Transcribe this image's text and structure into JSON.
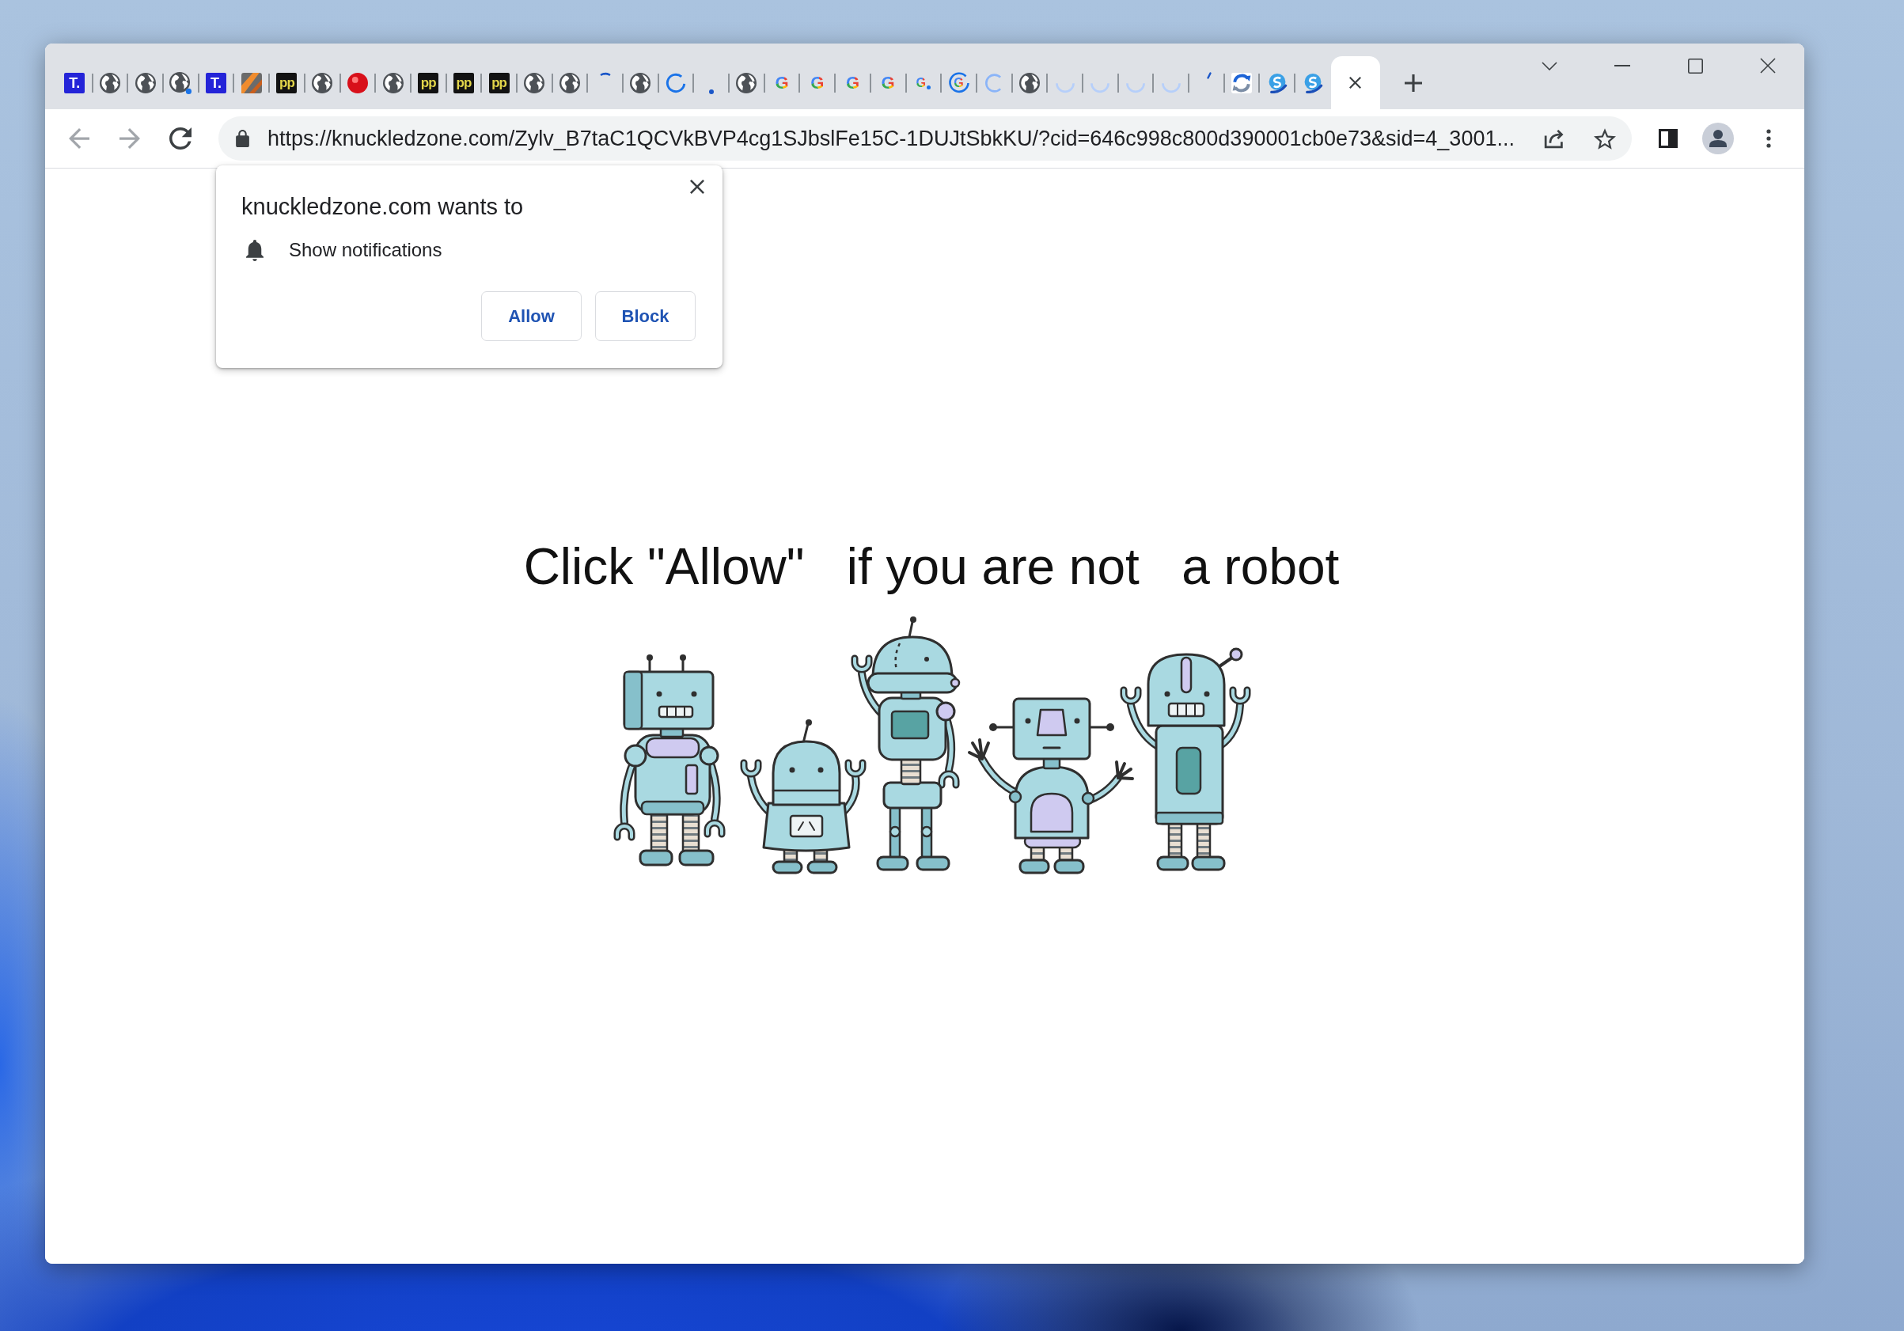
{
  "tabs": [
    {
      "kind": "tile",
      "text": "T.",
      "selected": false
    },
    {
      "kind": "globe",
      "selected": false
    },
    {
      "kind": "globe",
      "selected": false
    },
    {
      "kind": "globeload",
      "selected": false
    },
    {
      "kind": "tile",
      "text": "T.",
      "selected": false
    },
    {
      "kind": "photo",
      "selected": false
    },
    {
      "kind": "plate",
      "text": "pp",
      "selected": false
    },
    {
      "kind": "globe",
      "selected": false
    },
    {
      "kind": "dot",
      "selected": false
    },
    {
      "kind": "globe",
      "selected": false
    },
    {
      "kind": "plate",
      "text": "pp",
      "selected": false
    },
    {
      "kind": "plate",
      "text": "pp",
      "selected": false
    },
    {
      "kind": "plate",
      "text": "pp",
      "selected": false
    },
    {
      "kind": "globe",
      "selected": false
    },
    {
      "kind": "globe",
      "selected": false
    },
    {
      "kind": "spinstart",
      "selected": false
    },
    {
      "kind": "globe",
      "selected": false
    },
    {
      "kind": "spinner",
      "selected": false
    },
    {
      "kind": "speck",
      "selected": false
    },
    {
      "kind": "globe",
      "selected": false
    },
    {
      "kind": "google",
      "text": "G",
      "selected": false
    },
    {
      "kind": "google",
      "text": "G",
      "selected": false
    },
    {
      "kind": "google",
      "text": "G",
      "selected": false
    },
    {
      "kind": "google",
      "text": "G",
      "selected": false
    },
    {
      "kind": "googledot",
      "text": "G",
      "selected": false
    },
    {
      "kind": "googlering",
      "text": "G",
      "selected": false
    },
    {
      "kind": "spinlight",
      "selected": false
    },
    {
      "kind": "globe",
      "selected": false
    },
    {
      "kind": "spinfade",
      "selected": false
    },
    {
      "kind": "spinfade",
      "selected": false
    },
    {
      "kind": "spinfade",
      "selected": false
    },
    {
      "kind": "spinfade",
      "selected": false
    },
    {
      "kind": "spinend",
      "selected": false
    },
    {
      "kind": "arrows",
      "selected": false
    },
    {
      "kind": "swirl",
      "selected": false
    },
    {
      "kind": "swirl",
      "selected": false
    },
    {
      "selected": true
    }
  ],
  "toolbar": {
    "back": {
      "disabled": true
    },
    "forward": {
      "disabled": true
    },
    "address": "https://knuckledzone.com/Zylv_B7taC1QCVkBVP4cg1SJbslFe15C-1DUJtSbkKU/?cid=646c998c800d390001cb0e73&sid=4_3001..."
  },
  "prompt": {
    "title": "knuckledzone.com wants to",
    "permission": "Show notifications",
    "buttons": [
      "Allow",
      "Block"
    ]
  },
  "page": {
    "headline": "Click \"Allow\"   if you are not   a robot"
  }
}
